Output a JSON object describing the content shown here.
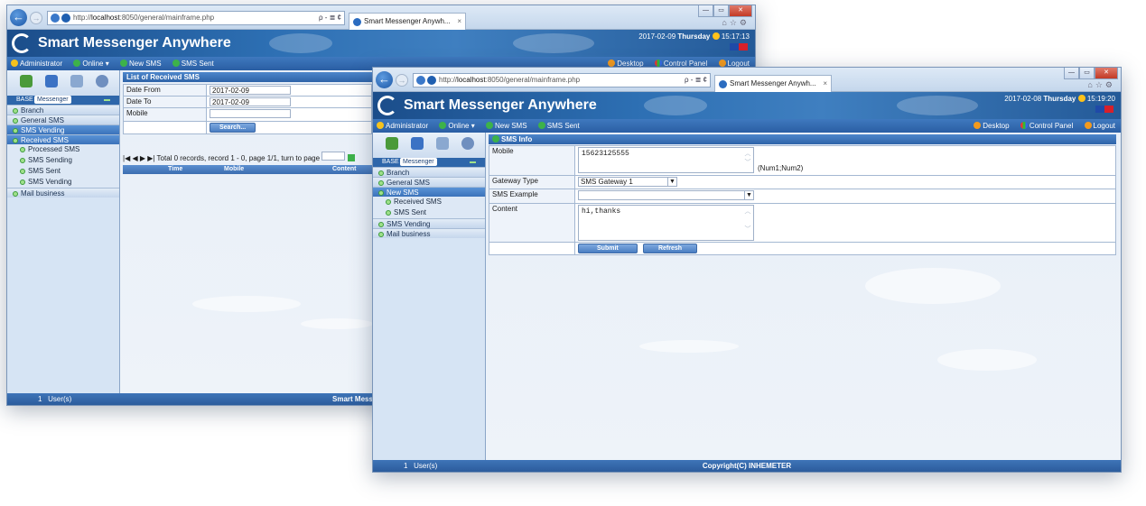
{
  "browser": {
    "url_prefix": "http://",
    "url_host": "localhost",
    "url_rest": ":8050/general/mainframe.php",
    "tab_title": "Smart Messenger Anywh...",
    "tab_close": "×",
    "addr_tools": "ρ - ≣ ¢",
    "win_min": "—",
    "win_max": "▭",
    "win_close": "✕",
    "ie_icons": "⌂☆⚙",
    "back": "←",
    "forward": "→"
  },
  "app": {
    "title": "Smart Messenger Anywhere",
    "flag": "EN"
  },
  "toolbar": {
    "user": "Administrator",
    "status": "Online",
    "new_sms": "New SMS",
    "sms_sent": "SMS Sent",
    "desktop": "Desktop",
    "control_panel": "Control Panel",
    "logout": "Logout"
  },
  "sidebar": {
    "base_label": "BASE",
    "messenger_label": "Messenger"
  },
  "window1": {
    "date": "2017-02-09",
    "day": "Thursday",
    "time": "15:17:13",
    "menu": [
      {
        "label": "Branch",
        "type": "group"
      },
      {
        "label": "General SMS",
        "type": "group"
      },
      {
        "label": "SMS Vending",
        "type": "group-active"
      },
      {
        "label": "Received SMS",
        "type": "group-active"
      },
      {
        "label": "Processed SMS",
        "type": "sub"
      },
      {
        "label": "SMS Sending",
        "type": "sub"
      },
      {
        "label": "SMS Sent",
        "type": "sub"
      },
      {
        "label": "SMS Vending",
        "type": "sub"
      },
      {
        "label": "Mail business",
        "type": "group"
      }
    ],
    "panel_title": "List of Received SMS",
    "date_from_label": "Date From",
    "date_from_value": "2017-02-09",
    "date_to_label": "Date To",
    "date_to_value": "2017-02-09",
    "mobile_label": "Mobile",
    "search_button": "Search...",
    "pager_text": "Total 0 records, record 1 - 0, page 1/1, turn to page",
    "pager_nav": "|◀  ◀  ▶  ▶|",
    "columns": [
      "Time",
      "Mobile",
      "Content"
    ],
    "users_count": "1",
    "users_label": "User(s)",
    "footer": "Smart Mess"
  },
  "window2": {
    "date": "2017-02-08",
    "day": "Thursday",
    "time": "15:19:20",
    "menu": [
      {
        "label": "Branch",
        "type": "group"
      },
      {
        "label": "General SMS",
        "type": "group"
      },
      {
        "label": "New SMS",
        "type": "group-active"
      },
      {
        "label": "Received SMS",
        "type": "sub"
      },
      {
        "label": "SMS Sent",
        "type": "sub"
      },
      {
        "label": "SMS Vending",
        "type": "group"
      },
      {
        "label": "Mail business",
        "type": "group"
      }
    ],
    "panel_title": "SMS Info",
    "mobile_label": "Mobile",
    "mobile_value": "15623125555",
    "mobile_hint": "(Num1;Num2)",
    "gateway_label": "Gateway Type",
    "gateway_value": "SMS Gateway 1",
    "example_label": "SMS Example",
    "example_value": "",
    "content_label": "Content",
    "content_value": "hi,thanks",
    "submit_button": "Submit",
    "refresh_button": "Refresh",
    "users_count": "1",
    "users_label": "User(s)",
    "footer": "Copyright(C) INHEMETER"
  }
}
